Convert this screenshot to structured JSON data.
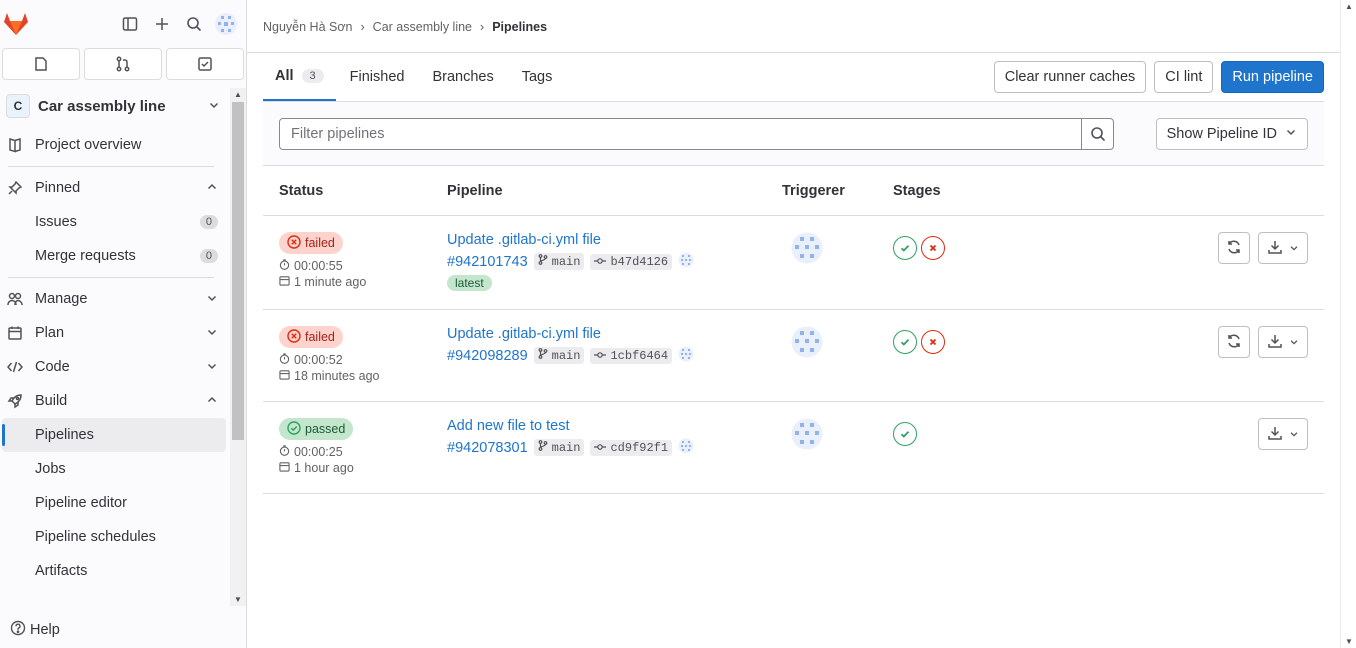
{
  "sidebar": {
    "project": {
      "avatar_letter": "C",
      "name": "Car assembly line"
    },
    "items": {
      "project_overview": "Project overview",
      "pinned": "Pinned",
      "issues": "Issues",
      "issues_count": "0",
      "merge_requests": "Merge requests",
      "merge_requests_count": "0",
      "manage": "Manage",
      "plan": "Plan",
      "code": "Code",
      "build": "Build",
      "pipelines": "Pipelines",
      "jobs": "Jobs",
      "pipeline_editor": "Pipeline editor",
      "pipeline_schedules": "Pipeline schedules",
      "artifacts": "Artifacts"
    },
    "help": "Help"
  },
  "breadcrumb": {
    "user": "Nguyễn Hà Sơn",
    "project": "Car assembly line",
    "current": "Pipelines"
  },
  "tabs": {
    "all": "All",
    "all_count": "3",
    "finished": "Finished",
    "branches": "Branches",
    "tags": "Tags"
  },
  "actions": {
    "clear_cache": "Clear runner caches",
    "ci_lint": "CI lint",
    "run_pipeline": "Run pipeline"
  },
  "filter": {
    "placeholder": "Filter pipelines",
    "show_id": "Show Pipeline ID"
  },
  "table": {
    "headers": {
      "status": "Status",
      "pipeline": "Pipeline",
      "triggerer": "Triggerer",
      "stages": "Stages"
    },
    "rows": [
      {
        "status": "failed",
        "duration": "00:00:55",
        "finished": "1 minute ago",
        "title": "Update .gitlab-ci.yml file",
        "id": "#942101743",
        "branch": "main",
        "commit": "b47d4126",
        "tag": "latest"
      },
      {
        "status": "failed",
        "duration": "00:00:52",
        "finished": "18 minutes ago",
        "title": "Update .gitlab-ci.yml file",
        "id": "#942098289",
        "branch": "main",
        "commit": "1cbf6464"
      },
      {
        "status": "passed",
        "duration": "00:00:25",
        "finished": "1 hour ago",
        "title": "Add new file to test",
        "id": "#942078301",
        "branch": "main",
        "commit": "cd9f92f1"
      }
    ]
  },
  "colors": {
    "primary": "#1f75cb",
    "success": "#2da160",
    "danger": "#dd2b0e"
  }
}
